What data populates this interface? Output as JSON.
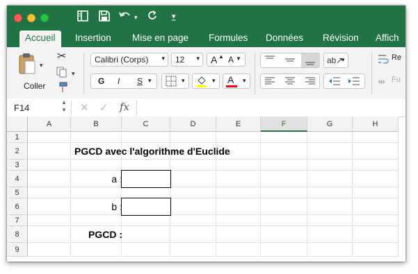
{
  "quick_access": {
    "sidebar_icon": "sidebar-icon",
    "save_icon": "save-icon",
    "undo_icon": "undo-icon",
    "redo_icon": "redo-icon",
    "customize_icon": "customize-icon"
  },
  "tabs": [
    {
      "label": "Accueil",
      "active": true
    },
    {
      "label": "Insertion"
    },
    {
      "label": "Mise en page"
    },
    {
      "label": "Formules"
    },
    {
      "label": "Données"
    },
    {
      "label": "Révision"
    },
    {
      "label": "Affich"
    }
  ],
  "ribbon": {
    "paste_label": "Coller",
    "font_name": "Calibri (Corps)",
    "font_size": "12",
    "bold": "G",
    "italic": "I",
    "underline": "S",
    "grow_font": "A",
    "shrink_font": "A",
    "font_color": "A",
    "wrap_label": "Re",
    "merge_label": "Fu"
  },
  "formula_bar": {
    "name_box": "F14",
    "fx": "fx",
    "value": ""
  },
  "columns": [
    "A",
    "B",
    "C",
    "D",
    "E",
    "F",
    "G",
    "H"
  ],
  "selected_column": "F",
  "rows": [
    "1",
    "2",
    "3",
    "4",
    "5",
    "6",
    "7",
    "8",
    "9"
  ],
  "sheet": {
    "title": "PGCD avec l'algorithme d'Euclide",
    "label_a": "a :",
    "label_b": "b :",
    "label_pgcd": "PGCD :"
  },
  "colors": {
    "accent": "#217346",
    "ribbon": "#f3f3f3"
  }
}
